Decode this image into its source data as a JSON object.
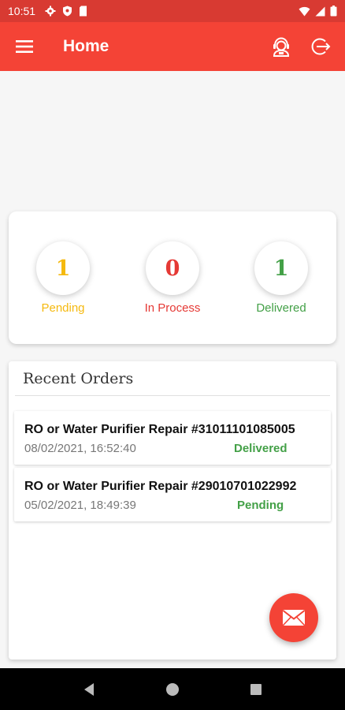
{
  "status_bar": {
    "time": "10:51"
  },
  "app_bar": {
    "title": "Home"
  },
  "stats": [
    {
      "count": "1",
      "label": "Pending",
      "color": "#f5b90f"
    },
    {
      "count": "0",
      "label": "In Process",
      "color": "#e53935"
    },
    {
      "count": "1",
      "label": "Delivered",
      "color": "#43a047"
    }
  ],
  "recent_orders": {
    "heading": "Recent Orders",
    "items": [
      {
        "title": "RO or Water Purifier Repair #31011101085005",
        "datetime": "08/02/2021, 16:52:40",
        "status": "Delivered"
      },
      {
        "title": "RO or Water Purifier Repair #29010701022992",
        "datetime": "05/02/2021, 18:49:39",
        "status": "Pending"
      }
    ]
  },
  "icons": {
    "menu": "menu-icon",
    "support": "customer-support-icon",
    "logout": "logout-icon",
    "fab": "mail-icon"
  },
  "colors": {
    "primary": "#f44336",
    "status_bar": "#d83a32"
  }
}
